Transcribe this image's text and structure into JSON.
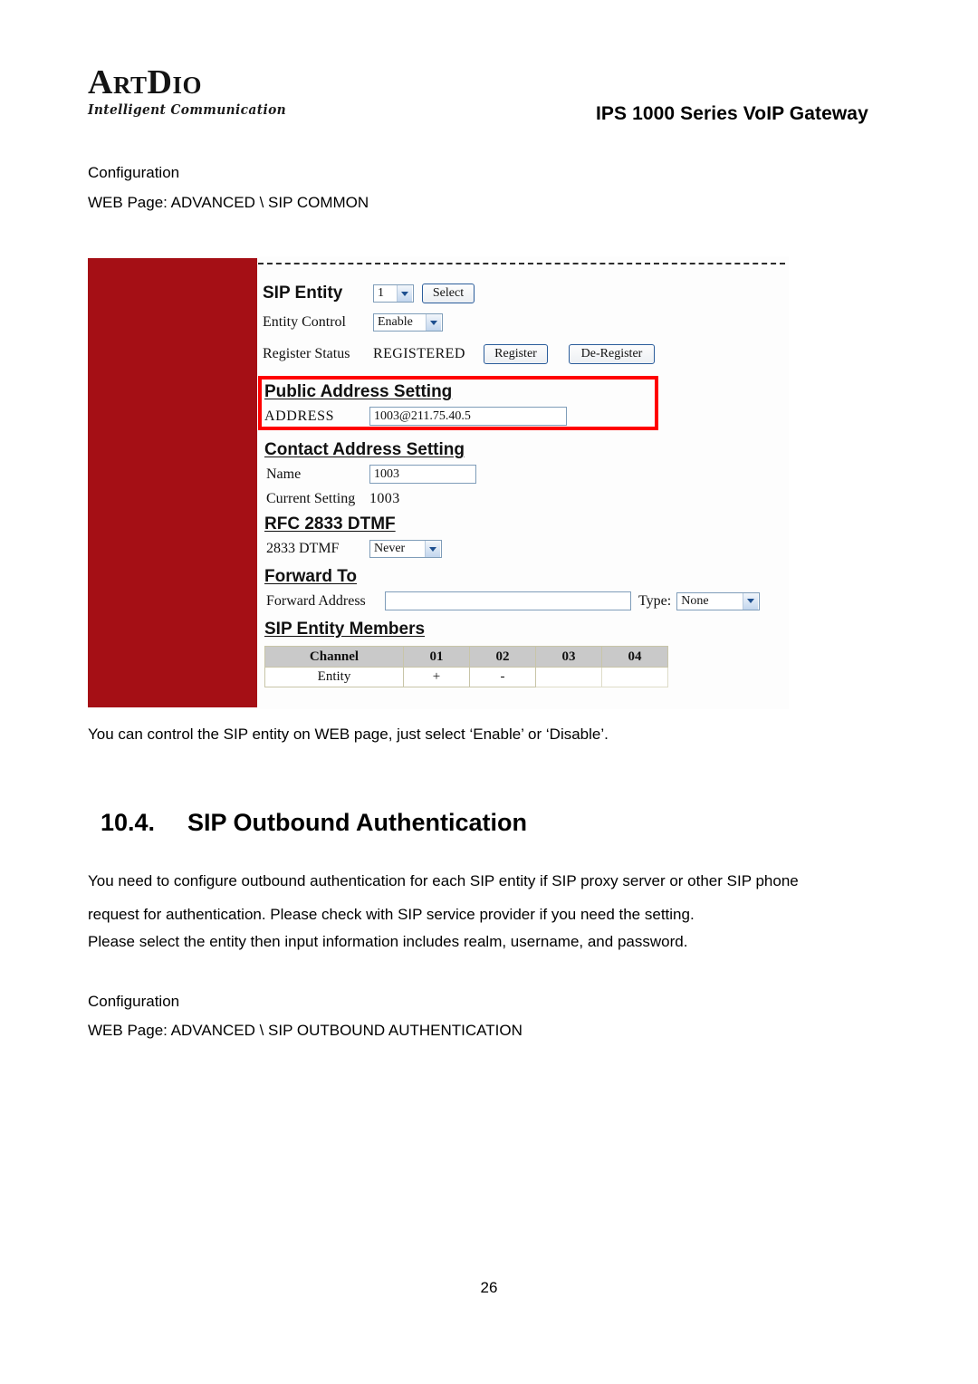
{
  "header": {
    "logo_main_a": "A",
    "logo_main_rt": "RT",
    "logo_main_d": "D",
    "logo_main_io": "IO",
    "logo_tagline": "Intelligent Communication",
    "product_title": "IPS 1000 Series VoIP Gateway"
  },
  "section_top": {
    "config_label": "Configuration",
    "web_page_path": "WEB Page: ADVANCED \\ SIP COMMON"
  },
  "screenshot": {
    "sip_entity": {
      "label": "SIP Entity",
      "entity_value": "1",
      "select_button": "Select"
    },
    "entity_control": {
      "label": "Entity Control",
      "value": "Enable"
    },
    "register_status": {
      "label": "Register Status",
      "status": "REGISTERED",
      "register_button": "Register",
      "deregister_button": "De-Register"
    },
    "public_address": {
      "heading": "Public Address Setting",
      "address_label": "ADDRESS",
      "address_value": "1003@211.75.40.5",
      "highlight_color": "#ff0000"
    },
    "contact_address": {
      "heading": "Contact Address Setting",
      "name_label": "Name",
      "name_value": "1003",
      "current_setting_label": "Current Setting",
      "current_setting_value": "1003"
    },
    "rfc2833": {
      "heading": "RFC 2833 DTMF",
      "dtmf_label": "2833 DTMF",
      "dtmf_value": "Never"
    },
    "forward_to": {
      "heading": "Forward To",
      "address_label": "Forward Address",
      "address_value": "",
      "type_label": "Type:",
      "type_value": "None"
    },
    "sip_entity_members": {
      "heading": "SIP Entity Members",
      "columns": [
        "Channel",
        "01",
        "02",
        "03",
        "04"
      ],
      "row_label": "Entity",
      "row_values": [
        "+",
        "-",
        "",
        ""
      ]
    },
    "sidebar_color": "#a50f15"
  },
  "body": {
    "note_line": "You can control the SIP entity on WEB page, just select ‘Enable’ or ‘Disable’.",
    "section_number": "10.4.",
    "section_title": "SIP Outbound Authentication",
    "paragraph_line_1": "You need to configure outbound authentication for each SIP entity if SIP proxy server or other SIP phone",
    "paragraph_line_2": "request for authentication. Please check with SIP service provider if you need the setting.",
    "paragraph_line_3": "Please select the entity then input information includes realm, username, and password.",
    "config_label": "Configuration",
    "web_page_path": "WEB Page: ADVANCED \\ SIP OUTBOUND AUTHENTICATION"
  },
  "footer": {
    "page_number": "26"
  }
}
